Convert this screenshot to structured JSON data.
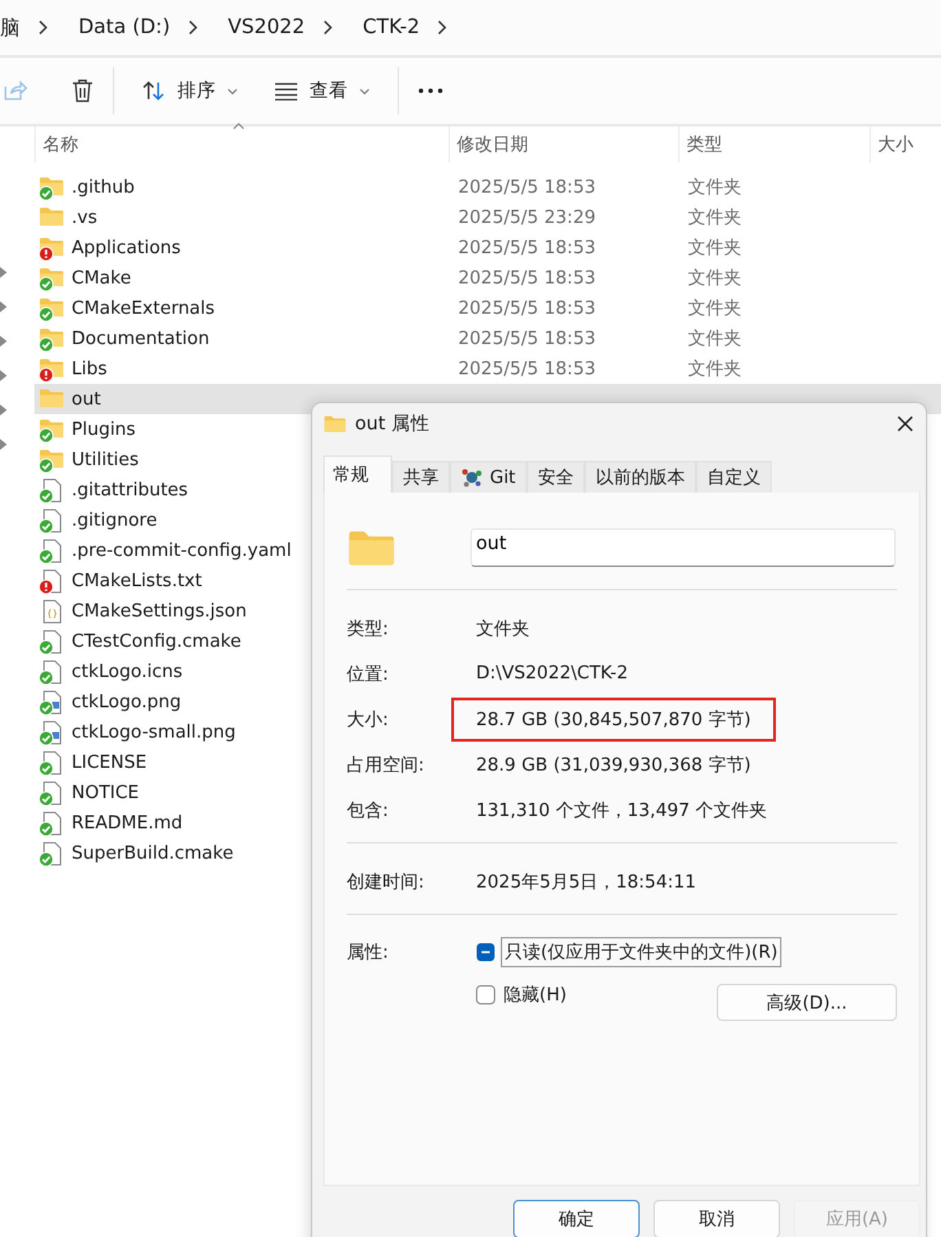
{
  "breadcrumb": [
    "脑",
    "Data (D:)",
    "VS2022",
    "CTK-2"
  ],
  "toolbar": {
    "sort": "排序",
    "view": "查看"
  },
  "columns": [
    "名称",
    "修改日期",
    "类型",
    "大小"
  ],
  "files": [
    {
      "name": ".github",
      "kind": "folder",
      "committed": true,
      "changed": false,
      "modified": "2025/5/5 18:53",
      "type": "文件夹",
      "selected": false
    },
    {
      "name": ".vs",
      "kind": "folder",
      "committed": false,
      "changed": false,
      "modified": "2025/5/5 23:29",
      "type": "文件夹",
      "selected": false
    },
    {
      "name": "Applications",
      "kind": "folder",
      "committed": false,
      "changed": true,
      "modified": "2025/5/5 18:53",
      "type": "文件夹",
      "selected": false
    },
    {
      "name": "CMake",
      "kind": "folder",
      "committed": true,
      "changed": false,
      "modified": "2025/5/5 18:53",
      "type": "文件夹",
      "selected": false
    },
    {
      "name": "CMakeExternals",
      "kind": "folder",
      "committed": true,
      "changed": false,
      "modified": "2025/5/5 18:53",
      "type": "文件夹",
      "selected": false
    },
    {
      "name": "Documentation",
      "kind": "folder",
      "committed": true,
      "changed": false,
      "modified": "2025/5/5 18:53",
      "type": "文件夹",
      "selected": false
    },
    {
      "name": "Libs",
      "kind": "folder",
      "committed": false,
      "changed": true,
      "modified": "2025/5/5 18:53",
      "type": "文件夹",
      "selected": false
    },
    {
      "name": "out",
      "kind": "folder",
      "committed": false,
      "changed": false,
      "selected": true
    },
    {
      "name": "Plugins",
      "kind": "folder",
      "committed": true,
      "changed": false,
      "selected": false
    },
    {
      "name": "Utilities",
      "kind": "folder",
      "committed": true,
      "changed": false,
      "selected": false
    },
    {
      "name": ".gitattributes",
      "kind": "file",
      "committed": true,
      "changed": false,
      "selected": false
    },
    {
      "name": ".gitignore",
      "kind": "file",
      "committed": true,
      "changed": false,
      "selected": false
    },
    {
      "name": ".pre-commit-config.yaml",
      "kind": "file",
      "committed": true,
      "changed": false,
      "selected": false
    },
    {
      "name": "CMakeLists.txt",
      "kind": "file",
      "committed": false,
      "changed": true,
      "selected": false
    },
    {
      "name": "CMakeSettings.json",
      "kind": "json",
      "committed": false,
      "changed": false,
      "selected": false
    },
    {
      "name": "CTestConfig.cmake",
      "kind": "file",
      "committed": true,
      "changed": false,
      "selected": false
    },
    {
      "name": "ctkLogo.icns",
      "kind": "file",
      "committed": true,
      "changed": false,
      "selected": false
    },
    {
      "name": "ctkLogo.png",
      "kind": "image",
      "committed": true,
      "changed": false,
      "selected": false
    },
    {
      "name": "ctkLogo-small.png",
      "kind": "image",
      "committed": true,
      "changed": false,
      "selected": false
    },
    {
      "name": "LICENSE",
      "kind": "file",
      "committed": true,
      "changed": false,
      "selected": false
    },
    {
      "name": "NOTICE",
      "kind": "file",
      "committed": true,
      "changed": false,
      "selected": false
    },
    {
      "name": "README.md",
      "kind": "file",
      "committed": true,
      "changed": false,
      "selected": false
    },
    {
      "name": "SuperBuild.cmake",
      "kind": "file",
      "committed": true,
      "changed": false,
      "selected": false
    }
  ],
  "dialog": {
    "title": "out 属性",
    "tabs": [
      {
        "label": "常规",
        "selected": true,
        "icon": false
      },
      {
        "label": "共享",
        "selected": false,
        "icon": false
      },
      {
        "label": "Git",
        "selected": false,
        "icon": true
      },
      {
        "label": "安全",
        "selected": false,
        "icon": false
      },
      {
        "label": "以前的版本",
        "selected": false,
        "icon": false
      },
      {
        "label": "自定义",
        "selected": false,
        "icon": false
      }
    ],
    "name_field": {
      "value": "out"
    },
    "groups": [
      [
        {
          "label": "类型:",
          "value": "文件夹",
          "highlighted": false
        },
        {
          "label": "位置:",
          "value": "D:\\VS2022\\CTK-2",
          "highlighted": false
        },
        {
          "label": "大小:",
          "value": "28.7 GB (30,845,507,870 字节)",
          "highlighted": true
        },
        {
          "label": "占用空间:",
          "value": "28.9 GB (31,039,930,368 字节)",
          "highlighted": false
        },
        {
          "label": "包含:",
          "value": "131,310 个文件，13,497 个文件夹",
          "highlighted": false
        }
      ],
      [
        {
          "label": "创建时间:",
          "value": "2025年5月5日，18:54:11",
          "highlighted": false
        }
      ]
    ],
    "attributes": {
      "label": "属性:",
      "options": [
        {
          "label": "只读(仅应用于文件夹中的文件)(R)",
          "checked": false,
          "mixed": true,
          "focused": true
        },
        {
          "label": "隐藏(H)",
          "checked": false,
          "mixed": false,
          "focused": false
        }
      ],
      "advanced": "高级(D)..."
    },
    "buttons": [
      {
        "label": "确定",
        "default": true,
        "disabled": false
      },
      {
        "label": "取消",
        "default": false,
        "disabled": false
      },
      {
        "label": "应用(A)",
        "default": false,
        "disabled": true
      }
    ]
  }
}
